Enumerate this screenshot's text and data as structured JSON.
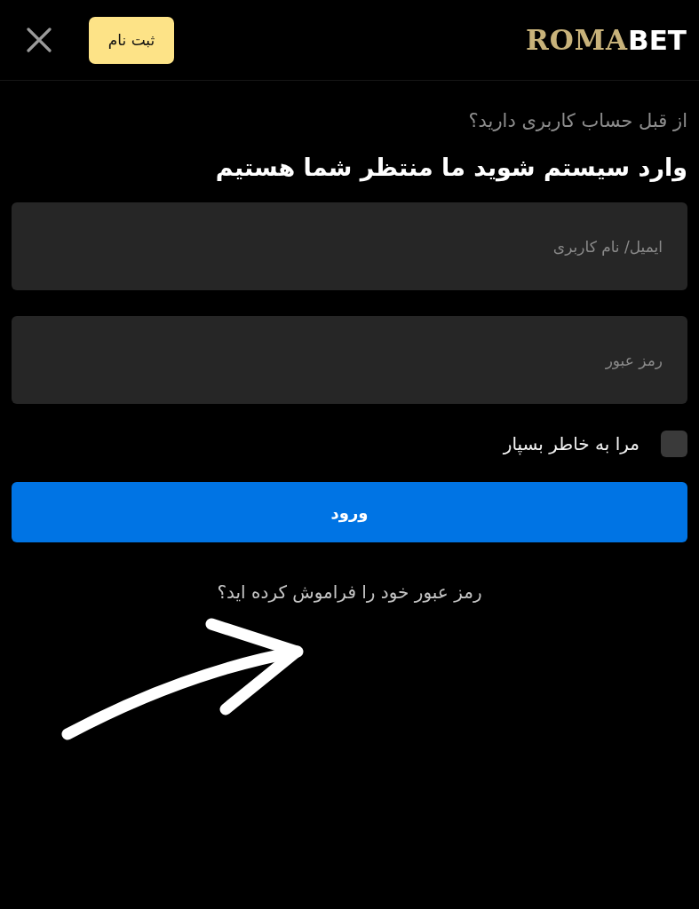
{
  "header": {
    "register_button": "ثبت نام",
    "logo": {
      "accent": "ROMA",
      "plain": "BET"
    }
  },
  "login": {
    "prompt": "از قبل حساب کاربری دارید؟",
    "heading": "وارد سیستم شوید ما منتظر شما هستیم",
    "fields": [
      {
        "placeholder": "ایمیل/ نام کاربری"
      },
      {
        "placeholder": "رمز عبور"
      }
    ],
    "remember_me": {
      "label": "مرا به خاطر بسپار",
      "checked": false
    },
    "submit_button": "ورود",
    "forgot_link": "رمز عبور خود را فراموش کرده اید؟"
  },
  "annotations": [
    {
      "kind": "arrow"
    }
  ]
}
